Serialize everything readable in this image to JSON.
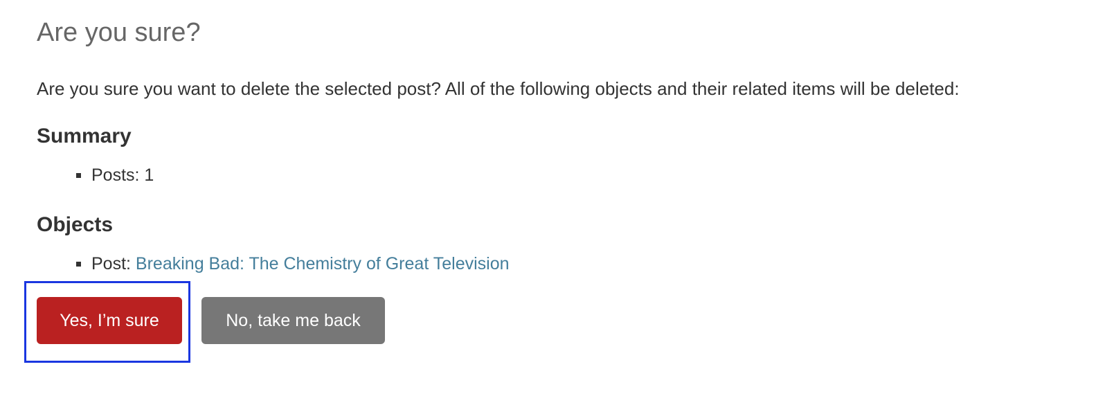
{
  "page_title": "Are you sure?",
  "intro_text": "Are you sure you want to delete the selected post? All of the following objects and their related items will be deleted:",
  "summary": {
    "heading": "Summary",
    "items": [
      {
        "text": "Posts: 1"
      }
    ]
  },
  "objects": {
    "heading": "Objects",
    "items": [
      {
        "prefix": "Post: ",
        "link_text": "Breaking Bad: The Chemistry of Great Television"
      }
    ]
  },
  "actions": {
    "confirm_label": "Yes, I’m sure",
    "cancel_label": "No, take me back"
  },
  "colors": {
    "confirm": "#ba2121",
    "cancel": "#777777",
    "link": "#447e9b",
    "focus_ring": "#1a36e0"
  }
}
